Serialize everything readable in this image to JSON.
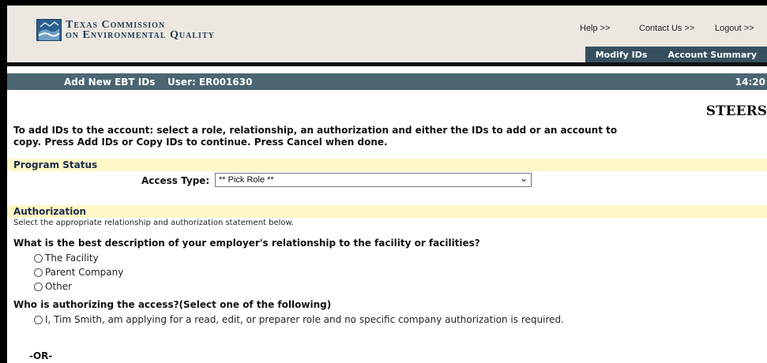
{
  "header": {
    "agency_line1": "Texas Commission",
    "agency_line2": "on Environmental Quality",
    "links": [
      "Help >>",
      "Contact Us >>",
      "Logout >>"
    ],
    "nav": [
      "Modify IDs",
      "Account Summary"
    ]
  },
  "status_bar": {
    "page": "Add New EBT IDs",
    "user": "User: ER001630",
    "time": "14:20"
  },
  "brand": "STEERS",
  "intro": "To add IDs to the account: select a role, relationship, an authorization and either the IDs to add or an account to copy. Press Add IDs or Copy IDs to continue. Press Cancel when done.",
  "program_status": {
    "heading": "Program Status",
    "access_label": "Access Type:",
    "access_value": "** Pick Role **"
  },
  "authorization": {
    "heading": "Authorization",
    "subtext": "Select the appropriate relationship and authorization statement below.",
    "q1": "What is the best description of your employer's relationship to the facility or facilities?",
    "q1_options": [
      "The Facility",
      "Parent Company",
      "Other"
    ],
    "q2": "Who is authorizing the access?(Select one of the following)",
    "q2_option1": "I, Tim Smith, am applying for a read, edit, or preparer role and no specific company authorization is required.",
    "or_label": "-OR-"
  }
}
